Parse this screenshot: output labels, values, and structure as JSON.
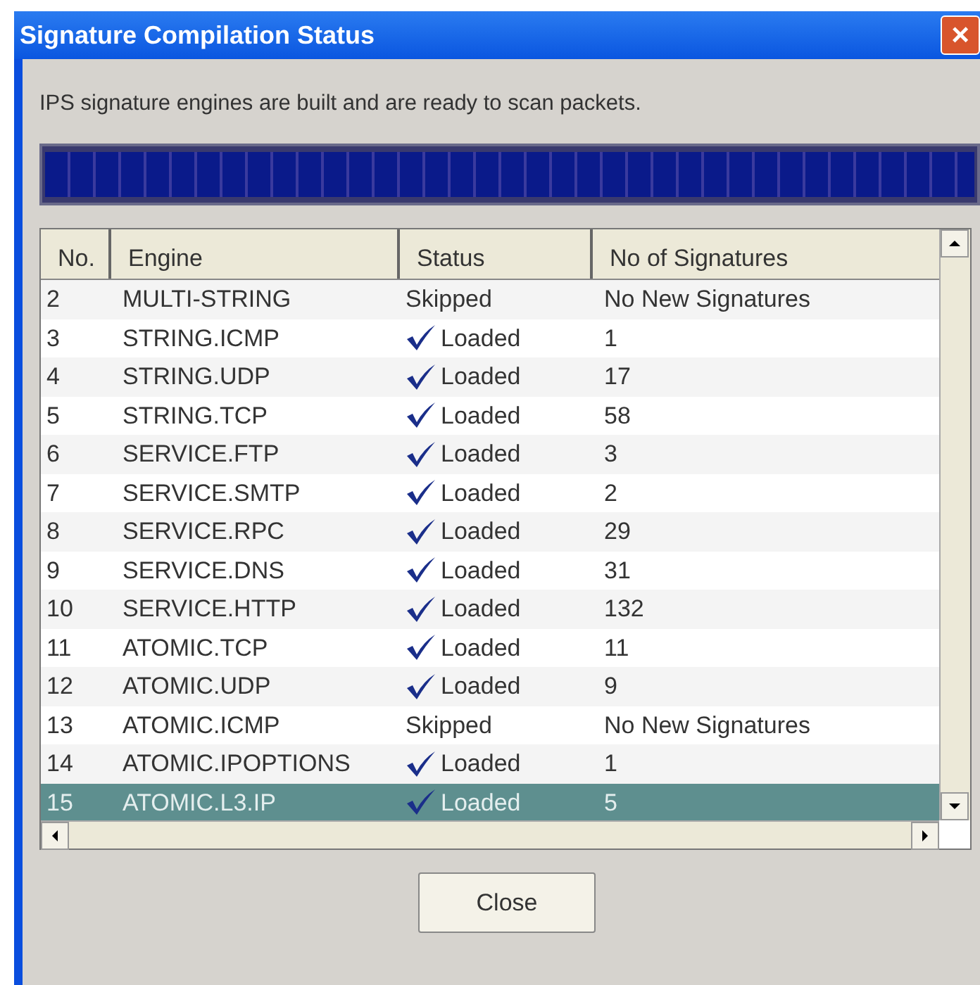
{
  "window": {
    "title": "Signature Compilation Status",
    "close_glyph": "×"
  },
  "message": "IPS signature engines are built and are ready to scan packets.",
  "progress": {
    "level": 1
  },
  "table": {
    "columns": [
      "No.",
      "Engine",
      "Status",
      "No of Signatures"
    ],
    "rows": [
      {
        "no": "2",
        "engine": "MULTI-STRING",
        "kind": "skipped",
        "status": "Skipped",
        "signatures": "No New Signatures",
        "selected": false
      },
      {
        "no": "3",
        "engine": "STRING.ICMP",
        "kind": "loaded",
        "status": "Loaded",
        "signatures": "1",
        "selected": false
      },
      {
        "no": "4",
        "engine": "STRING.UDP",
        "kind": "loaded",
        "status": "Loaded",
        "signatures": "17",
        "selected": false
      },
      {
        "no": "5",
        "engine": "STRING.TCP",
        "kind": "loaded",
        "status": "Loaded",
        "signatures": "58",
        "selected": false
      },
      {
        "no": "6",
        "engine": "SERVICE.FTP",
        "kind": "loaded",
        "status": "Loaded",
        "signatures": "3",
        "selected": false
      },
      {
        "no": "7",
        "engine": "SERVICE.SMTP",
        "kind": "loaded",
        "status": "Loaded",
        "signatures": "2",
        "selected": false
      },
      {
        "no": "8",
        "engine": "SERVICE.RPC",
        "kind": "loaded",
        "status": "Loaded",
        "signatures": "29",
        "selected": false
      },
      {
        "no": "9",
        "engine": "SERVICE.DNS",
        "kind": "loaded",
        "status": "Loaded",
        "signatures": "31",
        "selected": false
      },
      {
        "no": "10",
        "engine": "SERVICE.HTTP",
        "kind": "loaded",
        "status": "Loaded",
        "signatures": "132",
        "selected": false
      },
      {
        "no": "11",
        "engine": "ATOMIC.TCP",
        "kind": "loaded",
        "status": "Loaded",
        "signatures": "11",
        "selected": false
      },
      {
        "no": "12",
        "engine": "ATOMIC.UDP",
        "kind": "loaded",
        "status": "Loaded",
        "signatures": "9",
        "selected": false
      },
      {
        "no": "13",
        "engine": "ATOMIC.ICMP",
        "kind": "skipped",
        "status": "Skipped",
        "signatures": "No New Signatures",
        "selected": false
      },
      {
        "no": "14",
        "engine": "ATOMIC.IPOPTIONS",
        "kind": "loaded",
        "status": "Loaded",
        "signatures": "1",
        "selected": false
      },
      {
        "no": "15",
        "engine": "ATOMIC.L3.IP",
        "kind": "loaded",
        "status": "Loaded",
        "signatures": "5",
        "selected": true
      }
    ]
  },
  "buttons": [
    {
      "label": "Close"
    }
  ]
}
